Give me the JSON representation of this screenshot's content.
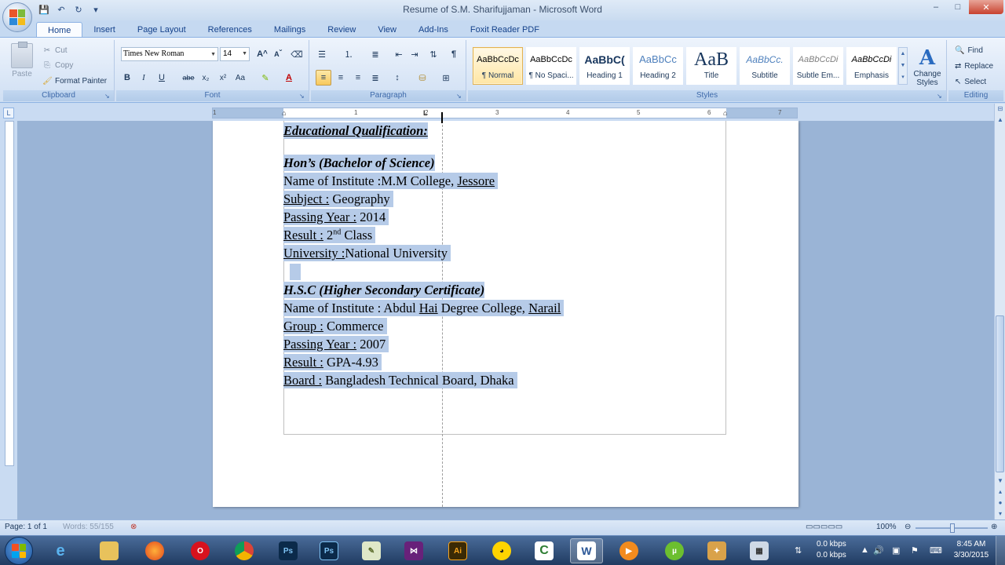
{
  "window": {
    "title": "Resume of S.M. Sharifujjaman - Microsoft Word",
    "controls": {
      "minimize": "–",
      "maximize": "□",
      "close": "✕"
    }
  },
  "quick_access": {
    "save_icon": "save-icon",
    "undo_icon": "undo-icon",
    "redo_icon": "redo-icon"
  },
  "ribbon": {
    "tabs": [
      "Home",
      "Insert",
      "Page Layout",
      "References",
      "Mailings",
      "Review",
      "View",
      "Add-Ins",
      "Foxit Reader PDF"
    ],
    "active_tab": "Home",
    "clipboard": {
      "label": "Clipboard",
      "paste": "Paste",
      "cut": "Cut",
      "copy": "Copy",
      "format_painter": "Format Painter"
    },
    "font": {
      "label": "Font",
      "font_name": "Times New Roman",
      "font_size": "14",
      "bold": "B",
      "italic": "I",
      "underline": "U",
      "strikethrough": "abe",
      "subscript": "x₂",
      "superscript": "x²",
      "change_case": "Aa",
      "grow": "A",
      "shrink": "A"
    },
    "paragraph": {
      "label": "Paragraph"
    },
    "styles": {
      "label": "Styles",
      "items": [
        {
          "sample": "AaBbCcDc",
          "name": "¶ Normal"
        },
        {
          "sample": "AaBbCcDc",
          "name": "¶ No Spaci..."
        },
        {
          "sample": "AaBbC(",
          "name": "Heading 1"
        },
        {
          "sample": "AaBbCc",
          "name": "Heading 2"
        },
        {
          "sample": "AaB",
          "name": "Title"
        },
        {
          "sample": "AaBbCc.",
          "name": "Subtitle"
        },
        {
          "sample": "AaBbCcDi",
          "name": "Subtle Em..."
        },
        {
          "sample": "AaBbCcDi",
          "name": "Emphasis"
        }
      ],
      "change_styles": "Change Styles"
    },
    "editing": {
      "label": "Editing",
      "find": "Find",
      "replace": "Replace",
      "select": "Select"
    }
  },
  "ruler": {
    "numbers": [
      "1",
      "1",
      "2",
      "3",
      "4",
      "5",
      "6",
      "7"
    ]
  },
  "document": {
    "heading": "Educational Qualification:",
    "section1": {
      "title": "Hon’s (Bachelor of Science)",
      "institute_label": "Name of Institute :",
      "institute_value": "M.M College, ",
      "institute_city": "Jessore",
      "subject_label": "Subject :",
      "subject_value": "Geography",
      "year_label": "Passing Year :",
      "year_value": "2014",
      "result_label": "Result :",
      "result_value_num": "2",
      "result_value_sup": "nd",
      "result_value_rest": " Class",
      "university_label": "University :",
      "university_value": "National University"
    },
    "section2": {
      "title": "H.S.C (Higher Secondary Certificate)",
      "institute_label": "Name of Institute :",
      "institute_value_a": "Abdul ",
      "institute_value_hai": "Hai",
      "institute_value_b": " Degree College, ",
      "institute_city": "Narail",
      "group_label": "Group :",
      "group_value": "Commerce",
      "year_label": "Passing Year :",
      "year_value": "2007",
      "result_label": "Result :",
      "result_value": "GPA-4.93",
      "board_label": "Board :",
      "board_value": "Bangladesh Technical Board, Dhaka"
    }
  },
  "statusbar": {
    "page": "Page: 1 of 1",
    "words": "Words: 55/155",
    "zoom": "100%"
  },
  "taskbar": {
    "apps": [
      "internet-explorer",
      "file-explorer",
      "firefox",
      "opera",
      "chrome",
      "photoshop",
      "photoshop",
      "notepad",
      "visual-studio",
      "illustrator",
      "cyberghost",
      "camtasia",
      "word",
      "media-player",
      "utorrent",
      "tools",
      "calculator"
    ],
    "net_up": "0.0 kbps",
    "net_down": "0.0 kbps",
    "time": "8:45 AM",
    "date": "3/30/2015"
  }
}
